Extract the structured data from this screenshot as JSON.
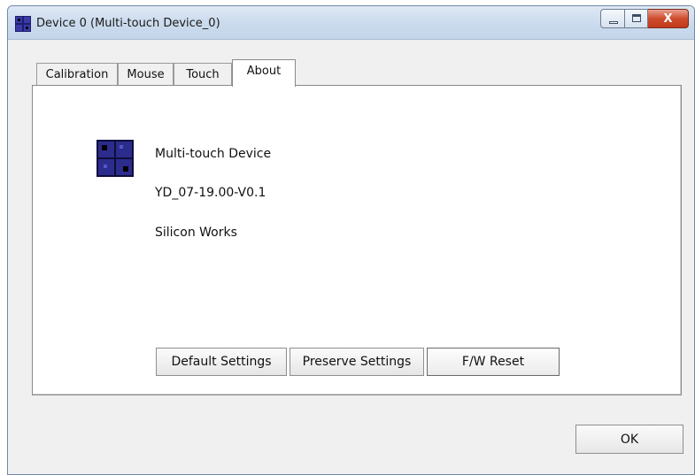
{
  "window": {
    "title": "Device 0 (Multi-touch Device_0)",
    "close_glyph": "X",
    "icons": {
      "app": "touch-device-icon",
      "minimize": "minimize-icon",
      "maximize": "maximize-icon",
      "close": "close-icon"
    }
  },
  "tabs": [
    {
      "label": "Calibration",
      "active": false
    },
    {
      "label": "Mouse",
      "active": false
    },
    {
      "label": "Touch",
      "active": false
    },
    {
      "label": "About",
      "active": true
    }
  ],
  "about": {
    "device_name": "Multi-touch Device",
    "firmware_version": "YD_07-19.00-V0.1",
    "vendor": "Silicon Works",
    "icon": "touch-device-icon"
  },
  "buttons": {
    "default_settings": "Default Settings",
    "preserve_settings": "Preserve Settings",
    "fw_reset": "F/W Reset",
    "ok": "OK"
  },
  "colors": {
    "title_bar": "#cddcee",
    "close_button": "#c2391b",
    "device_icon": "#2c2c8c"
  }
}
